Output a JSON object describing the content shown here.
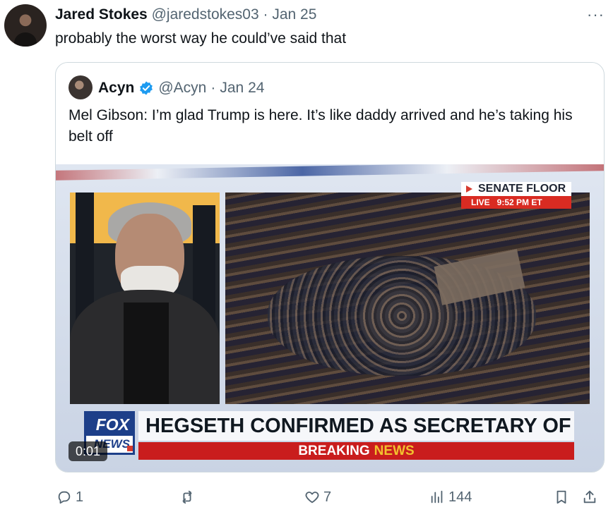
{
  "post": {
    "author_name": "Jared Stokes",
    "handle": "@jaredstokes03",
    "date": "Jan 25",
    "text": "probably the worst way he could’ve said that",
    "more_icon": "more-horizontal-icon"
  },
  "quoted": {
    "author_name": "Acyn",
    "handle": "@Acyn",
    "date": "Jan 24",
    "text": "Mel Gibson: I’m glad Trump is here. It’s like daddy arrived and he’s taking his belt off",
    "verified_color": "#1D9BF0",
    "video": {
      "timer": "0:01",
      "senate_title": "SENATE FLOOR",
      "live_label": "LIVE",
      "time_label": "9:52 PM ET",
      "logo_top": "FOX",
      "logo_bottom": "NEWS",
      "headline": "HEGSETH CONFIRMED AS SECRETARY OF DEFENSE",
      "breaking_prefix": "BREAKING",
      "breaking_suffix": "NEWS"
    }
  },
  "actions": {
    "reply_count": "1",
    "retweet_count": "",
    "like_count": "7",
    "views_count": "144",
    "icons": [
      "reply-icon",
      "retweet-icon",
      "like-icon",
      "views-icon",
      "bookmark-icon",
      "share-icon"
    ]
  }
}
